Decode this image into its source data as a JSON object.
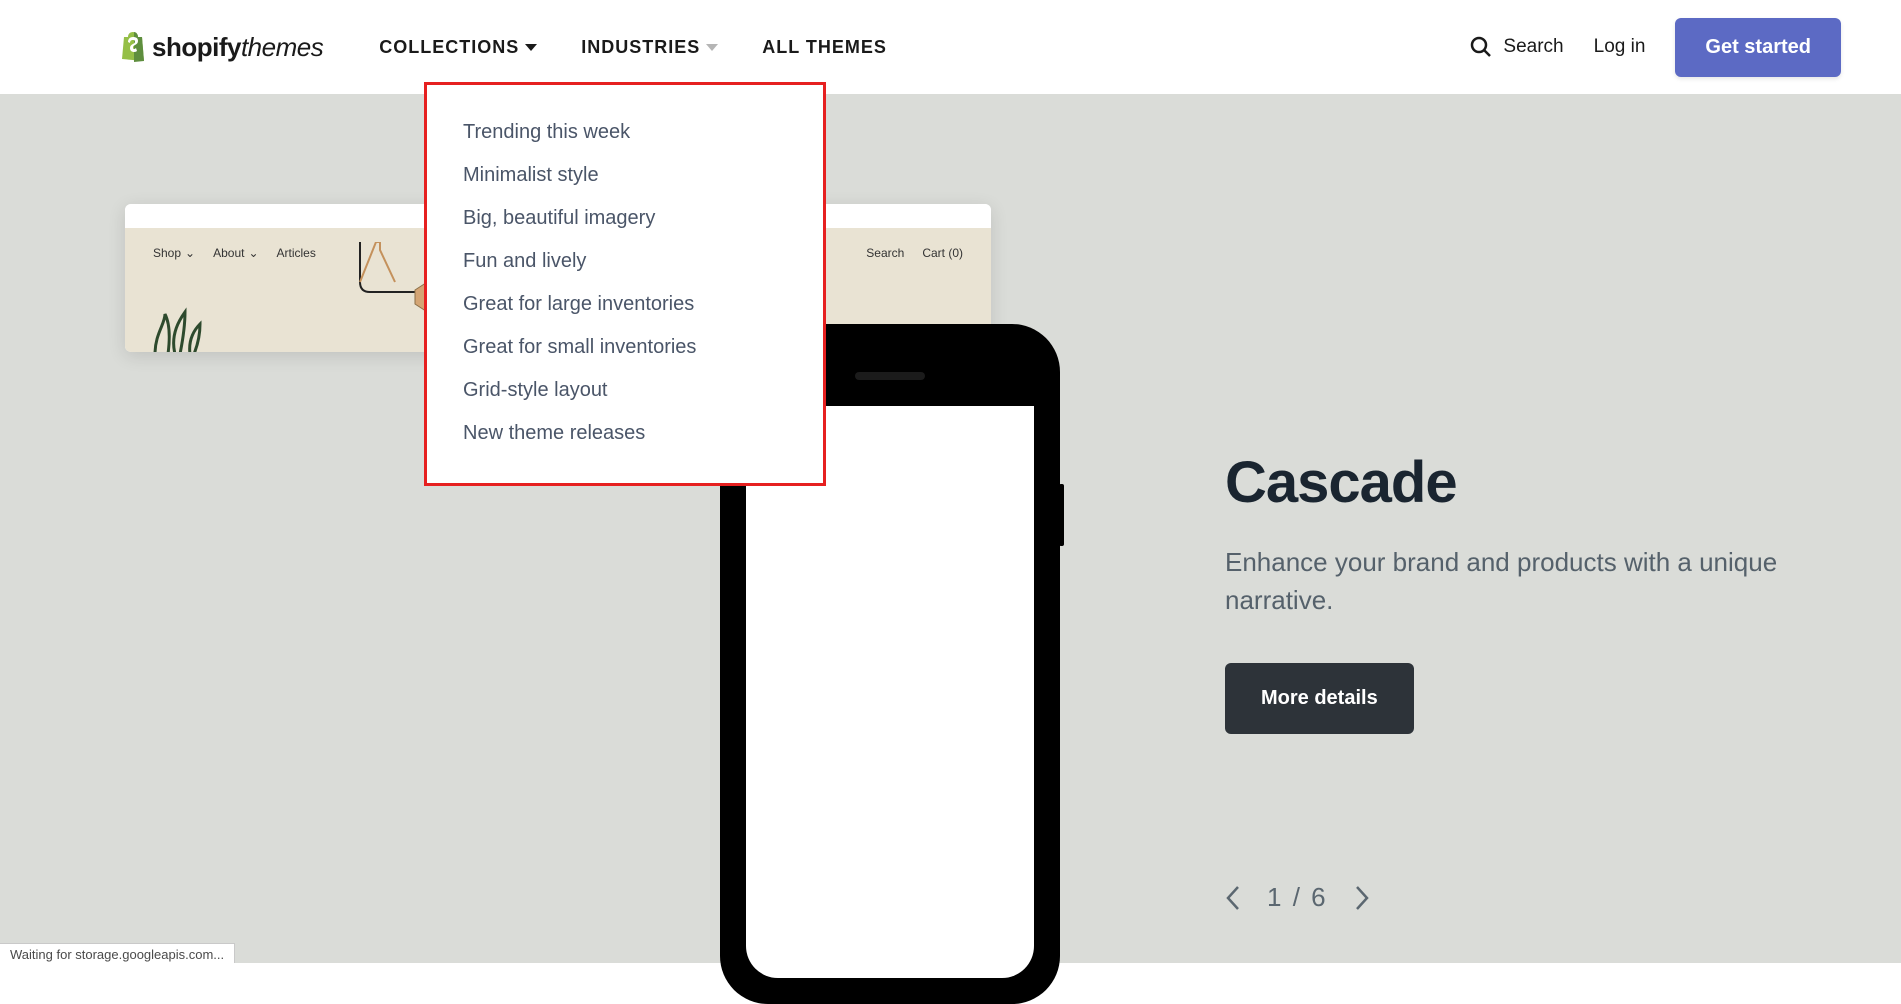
{
  "header": {
    "logo_text_bold": "shopify",
    "logo_text_light": "themes",
    "nav": {
      "collections": "COLLECTIONS",
      "industries": "INDUSTRIES",
      "all_themes": "ALL THEMES"
    },
    "search_label": "Search",
    "login_label": "Log in",
    "cta_label": "Get started"
  },
  "dropdown": {
    "items": [
      "Trending this week",
      "Minimalist style",
      "Big, beautiful imagery",
      "Fun and lively",
      "Great for large inventories",
      "Great for small inventories",
      "Grid-style layout",
      "New theme releases"
    ]
  },
  "theme_preview": {
    "nav_left": [
      "Shop",
      "About",
      "Articles"
    ],
    "nav_right": [
      "Search",
      "Cart (0)"
    ]
  },
  "hero": {
    "title": "Cascade",
    "subtitle": "Enhance your brand and products with a unique narrative.",
    "details_btn": "More details"
  },
  "pager": {
    "current": "1",
    "sep": "/",
    "total": "6"
  },
  "status_bar": "Waiting for storage.googleapis.com...",
  "colors": {
    "cta": "#5c6ac4",
    "dropdown_border": "#e62020",
    "hero_bg": "#dadcd8"
  }
}
